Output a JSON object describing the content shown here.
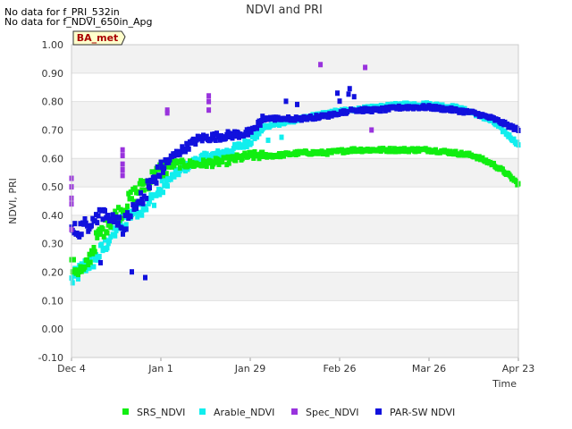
{
  "notices": [
    "No data for f_PRI_532in",
    "No data for f_NDVI_650in_Apg"
  ],
  "badge": "BA_met",
  "chart_data": {
    "type": "scatter",
    "title": "NDVI and PRI",
    "xlabel": "Time",
    "ylabel": "NDVI, PRI",
    "ylim": [
      -0.1,
      1.0
    ],
    "xlim_days": [
      0,
      140
    ],
    "x_ticks": [
      {
        "label": "Dec 4",
        "day": 0
      },
      {
        "label": "Jan 1",
        "day": 28
      },
      {
        "label": "Jan 29",
        "day": 56
      },
      {
        "label": "Feb 26",
        "day": 84
      },
      {
        "label": "Mar 26",
        "day": 112
      },
      {
        "label": "Apr 23",
        "day": 140
      }
    ],
    "y_ticks": [
      "-0.10",
      "0.00",
      "0.10",
      "0.20",
      "0.30",
      "0.40",
      "0.50",
      "0.60",
      "0.70",
      "0.80",
      "0.90",
      "1.00"
    ],
    "grid": "alternating horizontal bands",
    "legend_position": "bottom",
    "series": [
      {
        "name": "SRS_NDVI",
        "color": "#11ee11",
        "key": [
          [
            0,
            0.22
          ],
          [
            4,
            0.2
          ],
          [
            8,
            0.32
          ],
          [
            12,
            0.38
          ],
          [
            16,
            0.42
          ],
          [
            20,
            0.48
          ],
          [
            24,
            0.52
          ],
          [
            28,
            0.56
          ],
          [
            32,
            0.58
          ],
          [
            36,
            0.58
          ],
          [
            40,
            0.58
          ],
          [
            48,
            0.59
          ],
          [
            56,
            0.61
          ],
          [
            64,
            0.61
          ],
          [
            72,
            0.62
          ],
          [
            80,
            0.62
          ],
          [
            88,
            0.63
          ],
          [
            96,
            0.63
          ],
          [
            104,
            0.63
          ],
          [
            112,
            0.63
          ],
          [
            120,
            0.62
          ],
          [
            126,
            0.61
          ],
          [
            132,
            0.58
          ],
          [
            136,
            0.55
          ],
          [
            140,
            0.51
          ]
        ]
      },
      {
        "name": "Arable_NDVI",
        "color": "#11eeee",
        "key": [
          [
            0,
            0.17
          ],
          [
            4,
            0.22
          ],
          [
            8,
            0.25
          ],
          [
            12,
            0.32
          ],
          [
            16,
            0.38
          ],
          [
            20,
            0.42
          ],
          [
            24,
            0.44
          ],
          [
            28,
            0.49
          ],
          [
            32,
            0.54
          ],
          [
            36,
            0.57
          ],
          [
            40,
            0.6
          ],
          [
            48,
            0.62
          ],
          [
            56,
            0.66
          ],
          [
            60,
            0.71
          ],
          [
            64,
            0.72
          ],
          [
            72,
            0.74
          ],
          [
            80,
            0.76
          ],
          [
            88,
            0.77
          ],
          [
            96,
            0.78
          ],
          [
            104,
            0.79
          ],
          [
            112,
            0.79
          ],
          [
            120,
            0.78
          ],
          [
            126,
            0.76
          ],
          [
            132,
            0.73
          ],
          [
            136,
            0.69
          ],
          [
            140,
            0.65
          ]
        ]
      },
      {
        "name": "Spec_NDVI",
        "color": "#9933dd",
        "points": [
          [
            0,
            0.53
          ],
          [
            0,
            0.5
          ],
          [
            0,
            0.46
          ],
          [
            0,
            0.44
          ],
          [
            0,
            0.35
          ],
          [
            16,
            0.63
          ],
          [
            16,
            0.61
          ],
          [
            16,
            0.58
          ],
          [
            16,
            0.56
          ],
          [
            16,
            0.54
          ],
          [
            30,
            0.77
          ],
          [
            30,
            0.76
          ],
          [
            43,
            0.82
          ],
          [
            43,
            0.8
          ],
          [
            43,
            0.77
          ],
          [
            78,
            0.93
          ],
          [
            92,
            0.92
          ],
          [
            94,
            0.7
          ]
        ]
      },
      {
        "name": "PAR-SW NDVI",
        "color": "#1111dd",
        "key": [
          [
            0,
            0.34
          ],
          [
            4,
            0.36
          ],
          [
            8,
            0.4
          ],
          [
            12,
            0.38
          ],
          [
            16,
            0.36
          ],
          [
            20,
            0.42
          ],
          [
            24,
            0.5
          ],
          [
            28,
            0.56
          ],
          [
            32,
            0.61
          ],
          [
            36,
            0.64
          ],
          [
            40,
            0.67
          ],
          [
            48,
            0.68
          ],
          [
            56,
            0.69
          ],
          [
            60,
            0.74
          ],
          [
            64,
            0.74
          ],
          [
            72,
            0.74
          ],
          [
            80,
            0.75
          ],
          [
            88,
            0.77
          ],
          [
            96,
            0.77
          ],
          [
            104,
            0.78
          ],
          [
            112,
            0.78
          ],
          [
            120,
            0.77
          ],
          [
            126,
            0.76
          ],
          [
            132,
            0.74
          ],
          [
            136,
            0.72
          ],
          [
            140,
            0.7
          ]
        ]
      }
    ]
  }
}
